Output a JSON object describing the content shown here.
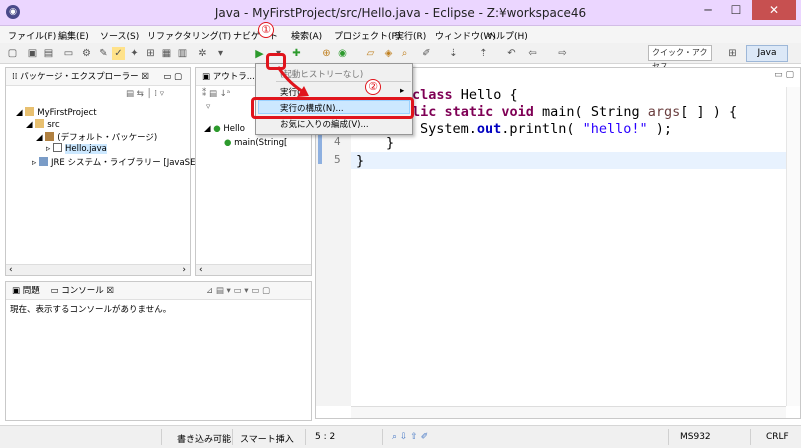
{
  "window": {
    "title": "Java - MyFirstProject/src/Hello.java - Eclipse - Z:¥workspace46",
    "minimize": "─",
    "maximize": "☐",
    "close": "✕"
  },
  "menu": [
    "ファイル(F)",
    "編集(E)",
    "ソース(S)",
    "リファクタリング(T)",
    "ナビゲート",
    "検索(A)",
    "プロジェクト(P)",
    "実行(R)",
    "ウィンドウ(W)",
    "ヘルプ(H)"
  ],
  "toolbar": {
    "quick_access": "クイック・アクセス",
    "perspective": "Java"
  },
  "package_explorer": {
    "tab": "パッケージ・エクスプローラー",
    "tree": [
      "MyFirstProject",
      "src",
      "(デフォルト・パッケージ)",
      "Hello.java",
      "JRE システム・ライブラリー [JavaSE-"
    ]
  },
  "outline": {
    "tab": "アウトラ...",
    "items": [
      "Hello",
      "main(String["
    ]
  },
  "editor": {
    "line_numbers": [
      "4",
      "5"
    ],
    "code": {
      "l1_kw": "class",
      "l1_rest": " Hello {",
      "l2_pre": "lic ",
      "l2_kw": "static void",
      "l2_mid": " main( String ",
      "l2_prm": "args",
      "l2_end": "[ ] ) {",
      "l3_pre": "System.",
      "l3_fld": "out",
      "l3_mid": ".println( ",
      "l3_str": "\"hello!\"",
      "l3_end": " );",
      "l4": "}",
      "l5": "}"
    }
  },
  "dropdown": {
    "history": "(起動ヒストリーなし)",
    "run_as": "実行(",
    "run_config": "実行の構成(N)...",
    "favorites": "お気に入りの編成(V)..."
  },
  "console": {
    "tab_problems": "問題",
    "tab_console": "コンソール",
    "message": "現在、表示するコンソールがありません。"
  },
  "status": {
    "writable": "書き込み可能",
    "insert": "スマート挿入",
    "position": "5 : 2",
    "encoding": "MS932",
    "line_ending": "CRLF"
  },
  "annotations": {
    "step1": "①",
    "step2": "②"
  },
  "colors": {
    "title_bg": "#ebd6ff",
    "highlight": "#e0141c",
    "selection": "#cce8ff"
  }
}
